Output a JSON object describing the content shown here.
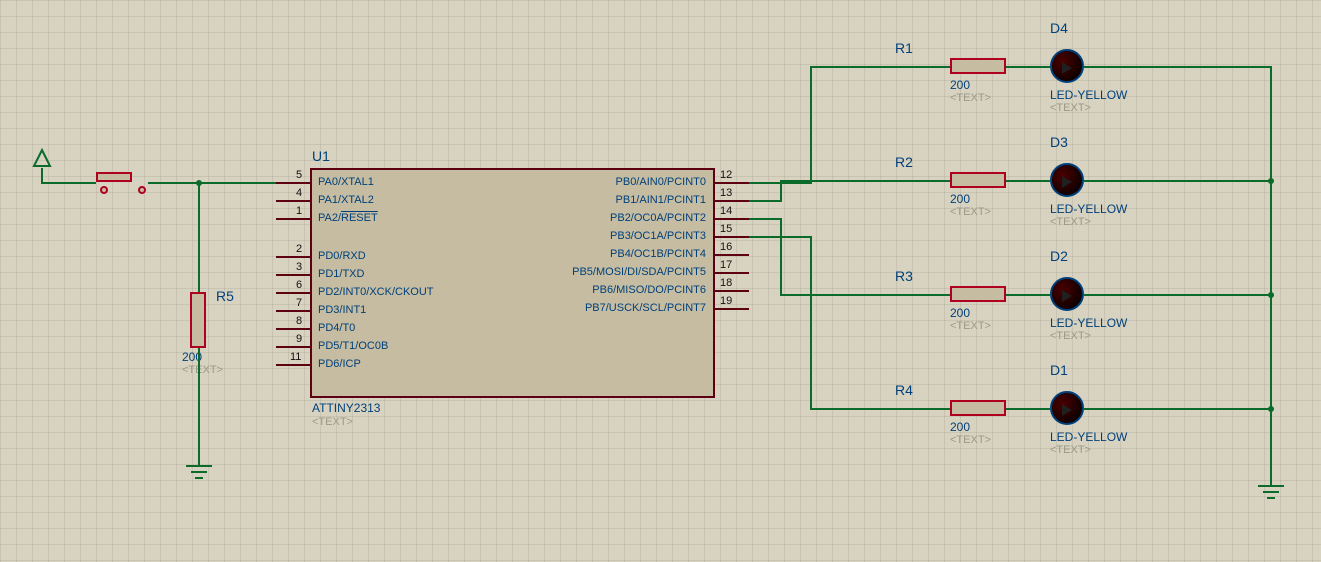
{
  "chip": {
    "ref": "U1",
    "part": "ATTINY2313",
    "placeholder": "<TEXT>",
    "left_pins": [
      {
        "num": "5",
        "name": "PA0/XTAL1"
      },
      {
        "num": "4",
        "name": "PA1/XTAL2"
      },
      {
        "num": "1",
        "name": "PA2/RESET",
        "overline_part": "RESET"
      },
      {
        "num": "2",
        "name": "PD0/RXD"
      },
      {
        "num": "3",
        "name": "PD1/TXD"
      },
      {
        "num": "6",
        "name": "PD2/INT0/XCK/CKOUT"
      },
      {
        "num": "7",
        "name": "PD3/INT1"
      },
      {
        "num": "8",
        "name": "PD4/T0"
      },
      {
        "num": "9",
        "name": "PD5/T1/OC0B"
      },
      {
        "num": "11",
        "name": "PD6/ICP"
      }
    ],
    "right_pins": [
      {
        "num": "12",
        "name": "PB0/AIN0/PCINT0"
      },
      {
        "num": "13",
        "name": "PB1/AIN1/PCINT1"
      },
      {
        "num": "14",
        "name": "PB2/OC0A/PCINT2"
      },
      {
        "num": "15",
        "name": "PB3/OC1A/PCINT3"
      },
      {
        "num": "16",
        "name": "PB4/OC1B/PCINT4"
      },
      {
        "num": "17",
        "name": "PB5/MOSI/DI/SDA/PCINT5"
      },
      {
        "num": "18",
        "name": "PB6/MISO/DO/PCINT6"
      },
      {
        "num": "19",
        "name": "PB7/USCK/SCL/PCINT7"
      }
    ]
  },
  "resistors": {
    "R1": {
      "ref": "R1",
      "value": "200",
      "placeholder": "<TEXT>"
    },
    "R2": {
      "ref": "R2",
      "value": "200",
      "placeholder": "<TEXT>"
    },
    "R3": {
      "ref": "R3",
      "value": "200",
      "placeholder": "<TEXT>"
    },
    "R4": {
      "ref": "R4",
      "value": "200",
      "placeholder": "<TEXT>"
    },
    "R5": {
      "ref": "R5",
      "value": "200",
      "placeholder": "<TEXT>"
    }
  },
  "leds": {
    "D4": {
      "ref": "D4",
      "part": "LED-YELLOW",
      "placeholder": "<TEXT>"
    },
    "D3": {
      "ref": "D3",
      "part": "LED-YELLOW",
      "placeholder": "<TEXT>"
    },
    "D2": {
      "ref": "D2",
      "part": "LED-YELLOW",
      "placeholder": "<TEXT>"
    },
    "D1": {
      "ref": "D1",
      "part": "LED-YELLOW",
      "placeholder": "<TEXT>"
    }
  }
}
